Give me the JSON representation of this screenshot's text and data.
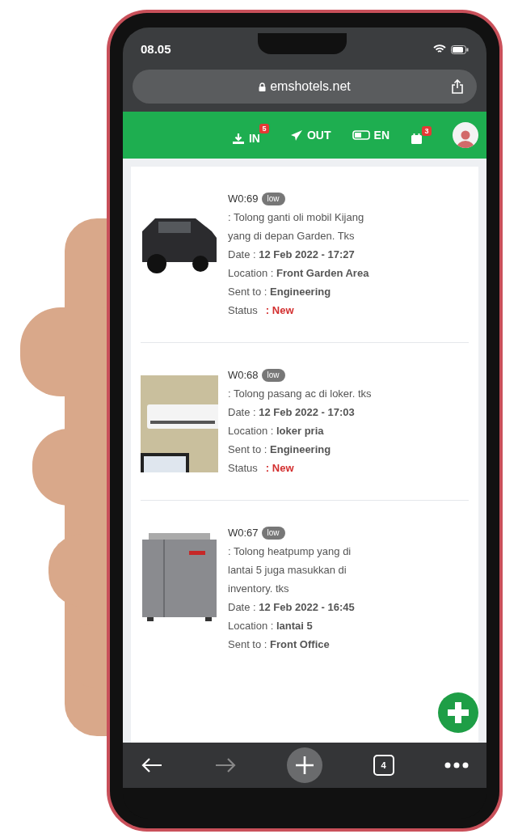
{
  "status_bar": {
    "time": "08.05"
  },
  "address_bar": {
    "url": "emshotels.net"
  },
  "nav": [
    {
      "kind": "inbox",
      "label": "IN",
      "badge": "5"
    },
    {
      "kind": "outbox",
      "label": "OUT"
    },
    {
      "kind": "language",
      "label": "EN"
    },
    {
      "kind": "calendar",
      "badge": "3"
    },
    {
      "kind": "avatar"
    }
  ],
  "work_orders": [
    {
      "kind": "car",
      "title": "W0:69",
      "priority": "low",
      "description": ": Tolong ganti oli mobil Kijang yang di depan Garden. Tks",
      "date": "Date : **12 Feb 2022 - 17:27**",
      "location": "Location : **Front Garden Area**",
      "sent_to": "Sent to : **Engineering**",
      "status_label": "Status",
      "status": ": New"
    },
    {
      "kind": "ac",
      "title": "W0:68",
      "priority": "low",
      "description": ": Tolong pasang ac di loker. tks",
      "date": "Date : **12 Feb 2022 - 17:03**",
      "location": "Location : **loker pria**",
      "sent_to": "Sent to : **Engineering**",
      "status_label": "Status",
      "status": ": New"
    },
    {
      "kind": "heatpump",
      "title": "W0:67",
      "priority": "low",
      "description": ": Tolong heatpump yang di lantai 5 juga masukkan di inventory. tks",
      "date": "Date : **12 Feb 2022 - 16:45**",
      "location": "Location : **lantai 5**",
      "sent_to": "Sent to : **Front Office**"
    }
  ],
  "toolbar": {
    "tab_count": "4"
  }
}
